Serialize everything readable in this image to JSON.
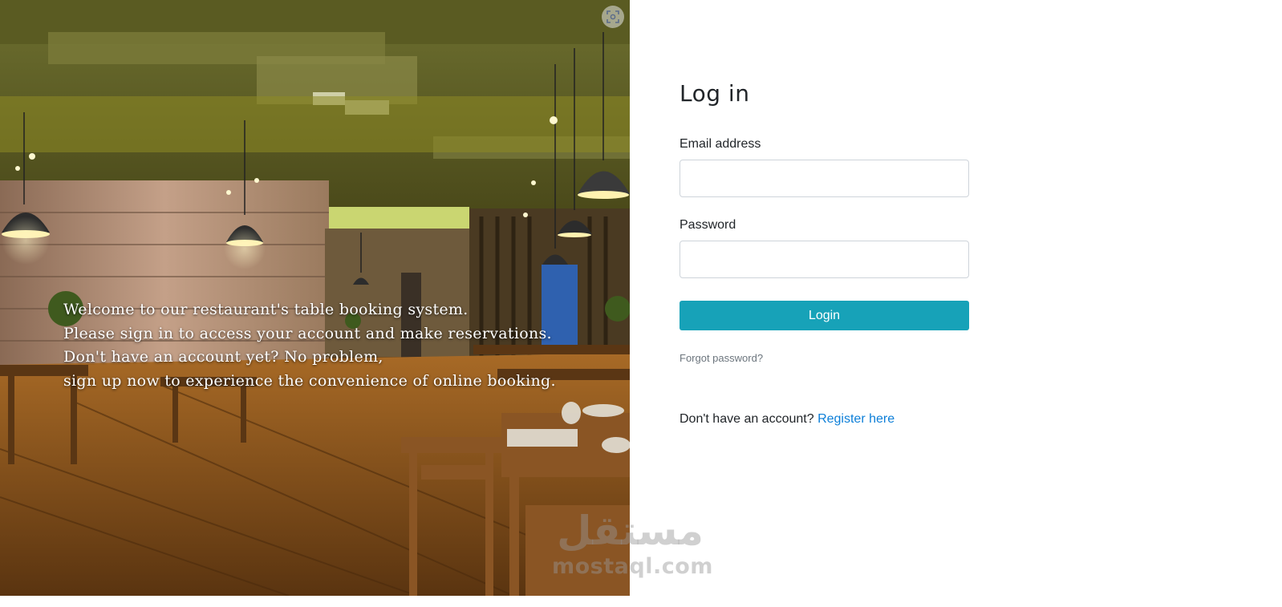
{
  "hero": {
    "lines": [
      "Welcome to our restaurant's table booking system.",
      "Please sign in to access your account and make reservations.",
      "Don't have an account yet? No problem,",
      "sign up now to experience the convenience of online booking."
    ],
    "icon": "screenshot-scan-icon"
  },
  "form": {
    "title": "Log in",
    "email_label": "Email address",
    "email_value": "",
    "email_placeholder": "",
    "password_label": "Password",
    "password_value": "",
    "password_placeholder": "",
    "login_button": "Login",
    "forgot_link": "Forgot password?",
    "register_prompt": "Don't have an account?",
    "register_link": "Register here"
  },
  "colors": {
    "primary_button": "#17a2b8",
    "link": "#0d7fd8",
    "muted_link": "#6c757d",
    "text": "#212529"
  },
  "watermark": {
    "arabic": "مستقل",
    "latin": "mostaql.com"
  }
}
